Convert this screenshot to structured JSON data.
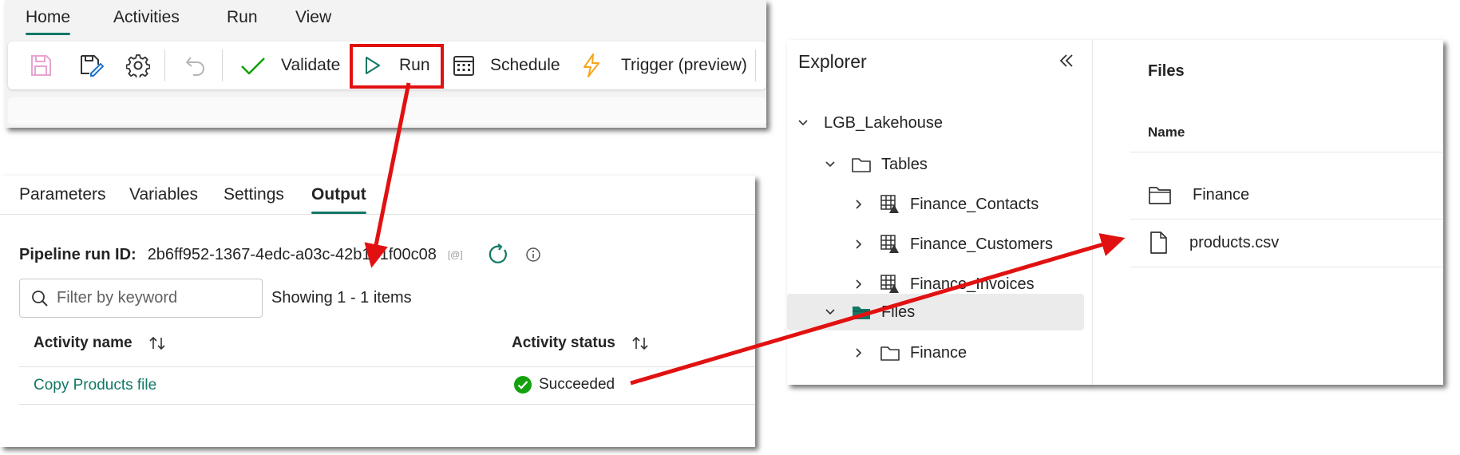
{
  "ribbon": {
    "tabs": [
      "Home",
      "Activities",
      "Run",
      "View"
    ],
    "toolbar": {
      "validate_label": "Validate",
      "run_label": "Run",
      "schedule_label": "Schedule",
      "trigger_label": "Trigger (preview)"
    }
  },
  "output": {
    "tabs": [
      "Parameters",
      "Variables",
      "Settings",
      "Output"
    ],
    "run_id_label": "Pipeline run ID:",
    "run_id_value": "2b6ff952-1367-4edc-a03c-42b131f00c08",
    "copy_badge": "[@]",
    "filter_placeholder": "Filter by keyword",
    "showing": "Showing 1 - 1 items",
    "columns": {
      "name": "Activity name",
      "status": "Activity status"
    },
    "rows": [
      {
        "name": "Copy Products file",
        "status": "Succeeded"
      }
    ]
  },
  "explorer": {
    "title": "Explorer",
    "lakehouse": "LGB_Lakehouse",
    "tables_label": "Tables",
    "tables": [
      "Finance_Contacts",
      "Finance_Customers",
      "Finance_Invoices"
    ],
    "files_label": "Files",
    "files_children": [
      "Finance"
    ]
  },
  "files_view": {
    "title": "Files",
    "column": "Name",
    "items": [
      {
        "name": "Finance",
        "icon": "folder-icon"
      },
      {
        "name": "products.csv",
        "icon": "file-icon"
      }
    ]
  },
  "colors": {
    "accent": "#117865",
    "highlight": "#e21111",
    "success": "#13a10e",
    "trigger": "#f7a51c"
  }
}
